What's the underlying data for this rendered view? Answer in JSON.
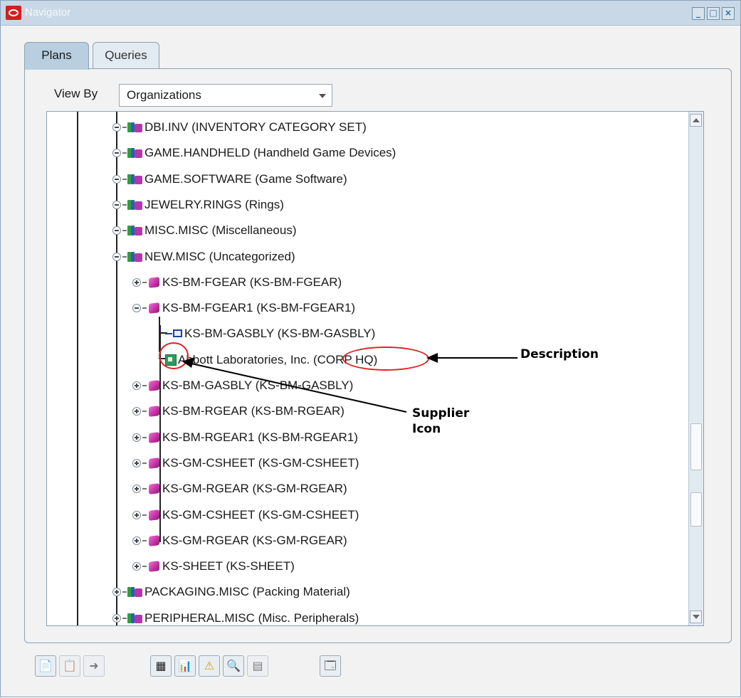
{
  "window": {
    "title": "Navigator",
    "controls": [
      "_",
      "□",
      "×"
    ]
  },
  "tabs": [
    {
      "label": "Plans",
      "active": true
    },
    {
      "label": "Queries",
      "active": false
    }
  ],
  "view_by": {
    "label": "View By",
    "value": "Organizations"
  },
  "tree": {
    "nodes": [
      {
        "kind": "category",
        "label": "DBI.INV (INVENTORY CATEGORY SET)",
        "toggle": "minus"
      },
      {
        "kind": "category",
        "label": "GAME.HANDHELD (Handheld Game Devices)",
        "toggle": "minus"
      },
      {
        "kind": "category",
        "label": "GAME.SOFTWARE (Game Software)",
        "toggle": "minus"
      },
      {
        "kind": "category",
        "label": "JEWELRY.RINGS (Rings)",
        "toggle": "minus"
      },
      {
        "kind": "category",
        "label": "MISC.MISC (Miscellaneous)",
        "toggle": "minus"
      },
      {
        "kind": "category",
        "label": "NEW.MISC (Uncategorized)",
        "toggle": "minus"
      },
      {
        "kind": "item",
        "label": "KS-BM-FGEAR (KS-BM-FGEAR)",
        "toggle": "plus"
      },
      {
        "kind": "item",
        "label": "KS-BM-FGEAR1 (KS-BM-FGEAR1)",
        "toggle": "minus"
      },
      {
        "kind": "component",
        "label": "KS-BM-GASBLY (KS-BM-GASBLY)"
      },
      {
        "kind": "supplier",
        "label": "Abbott Laboratories, Inc. (CORP HQ)"
      },
      {
        "kind": "item",
        "label": "KS-BM-GASBLY (KS-BM-GASBLY)",
        "toggle": "plus"
      },
      {
        "kind": "item",
        "label": "KS-BM-RGEAR (KS-BM-RGEAR)",
        "toggle": "plus"
      },
      {
        "kind": "item",
        "label": "KS-BM-RGEAR1 (KS-BM-RGEAR1)",
        "toggle": "plus"
      },
      {
        "kind": "item",
        "label": "KS-GM-CSHEET (KS-GM-CSHEET)",
        "toggle": "plus"
      },
      {
        "kind": "item",
        "label": "KS-GM-RGEAR (KS-GM-RGEAR)",
        "toggle": "plus"
      },
      {
        "kind": "item",
        "label": "KS-GM-CSHEET (KS-GM-CSHEET)",
        "toggle": "plus"
      },
      {
        "kind": "item",
        "label": "KS-GM-RGEAR (KS-GM-RGEAR)",
        "toggle": "plus"
      },
      {
        "kind": "item",
        "label": "KS-SHEET (KS-SHEET)",
        "toggle": "plus"
      },
      {
        "kind": "category",
        "label": "PACKAGING.MISC (Packing Material)",
        "toggle": "plus"
      },
      {
        "kind": "category",
        "label": "PERIPHERAL.MISC (Misc. Peripherals)",
        "toggle": "plus"
      }
    ]
  },
  "annotations": {
    "description": "Description",
    "supplier_icon": "Supplier Icon"
  },
  "toolbar": {
    "buttons": [
      {
        "name": "new-plan",
        "glyph": "📄",
        "enabled": true
      },
      {
        "name": "copy-plan",
        "glyph": "📋",
        "enabled": false
      },
      {
        "name": "launch-plan",
        "glyph": "➜",
        "enabled": false
      },
      {
        "name": "grid-view",
        "glyph": "▦",
        "enabled": true
      },
      {
        "name": "chart-view",
        "glyph": "📊",
        "enabled": true
      },
      {
        "name": "exceptions",
        "glyph": "⚠",
        "enabled": true
      },
      {
        "name": "find",
        "glyph": "🔍",
        "enabled": true
      },
      {
        "name": "properties",
        "glyph": "▤",
        "enabled": false
      },
      {
        "name": "workbench",
        "glyph": "🗔",
        "enabled": true
      }
    ]
  }
}
